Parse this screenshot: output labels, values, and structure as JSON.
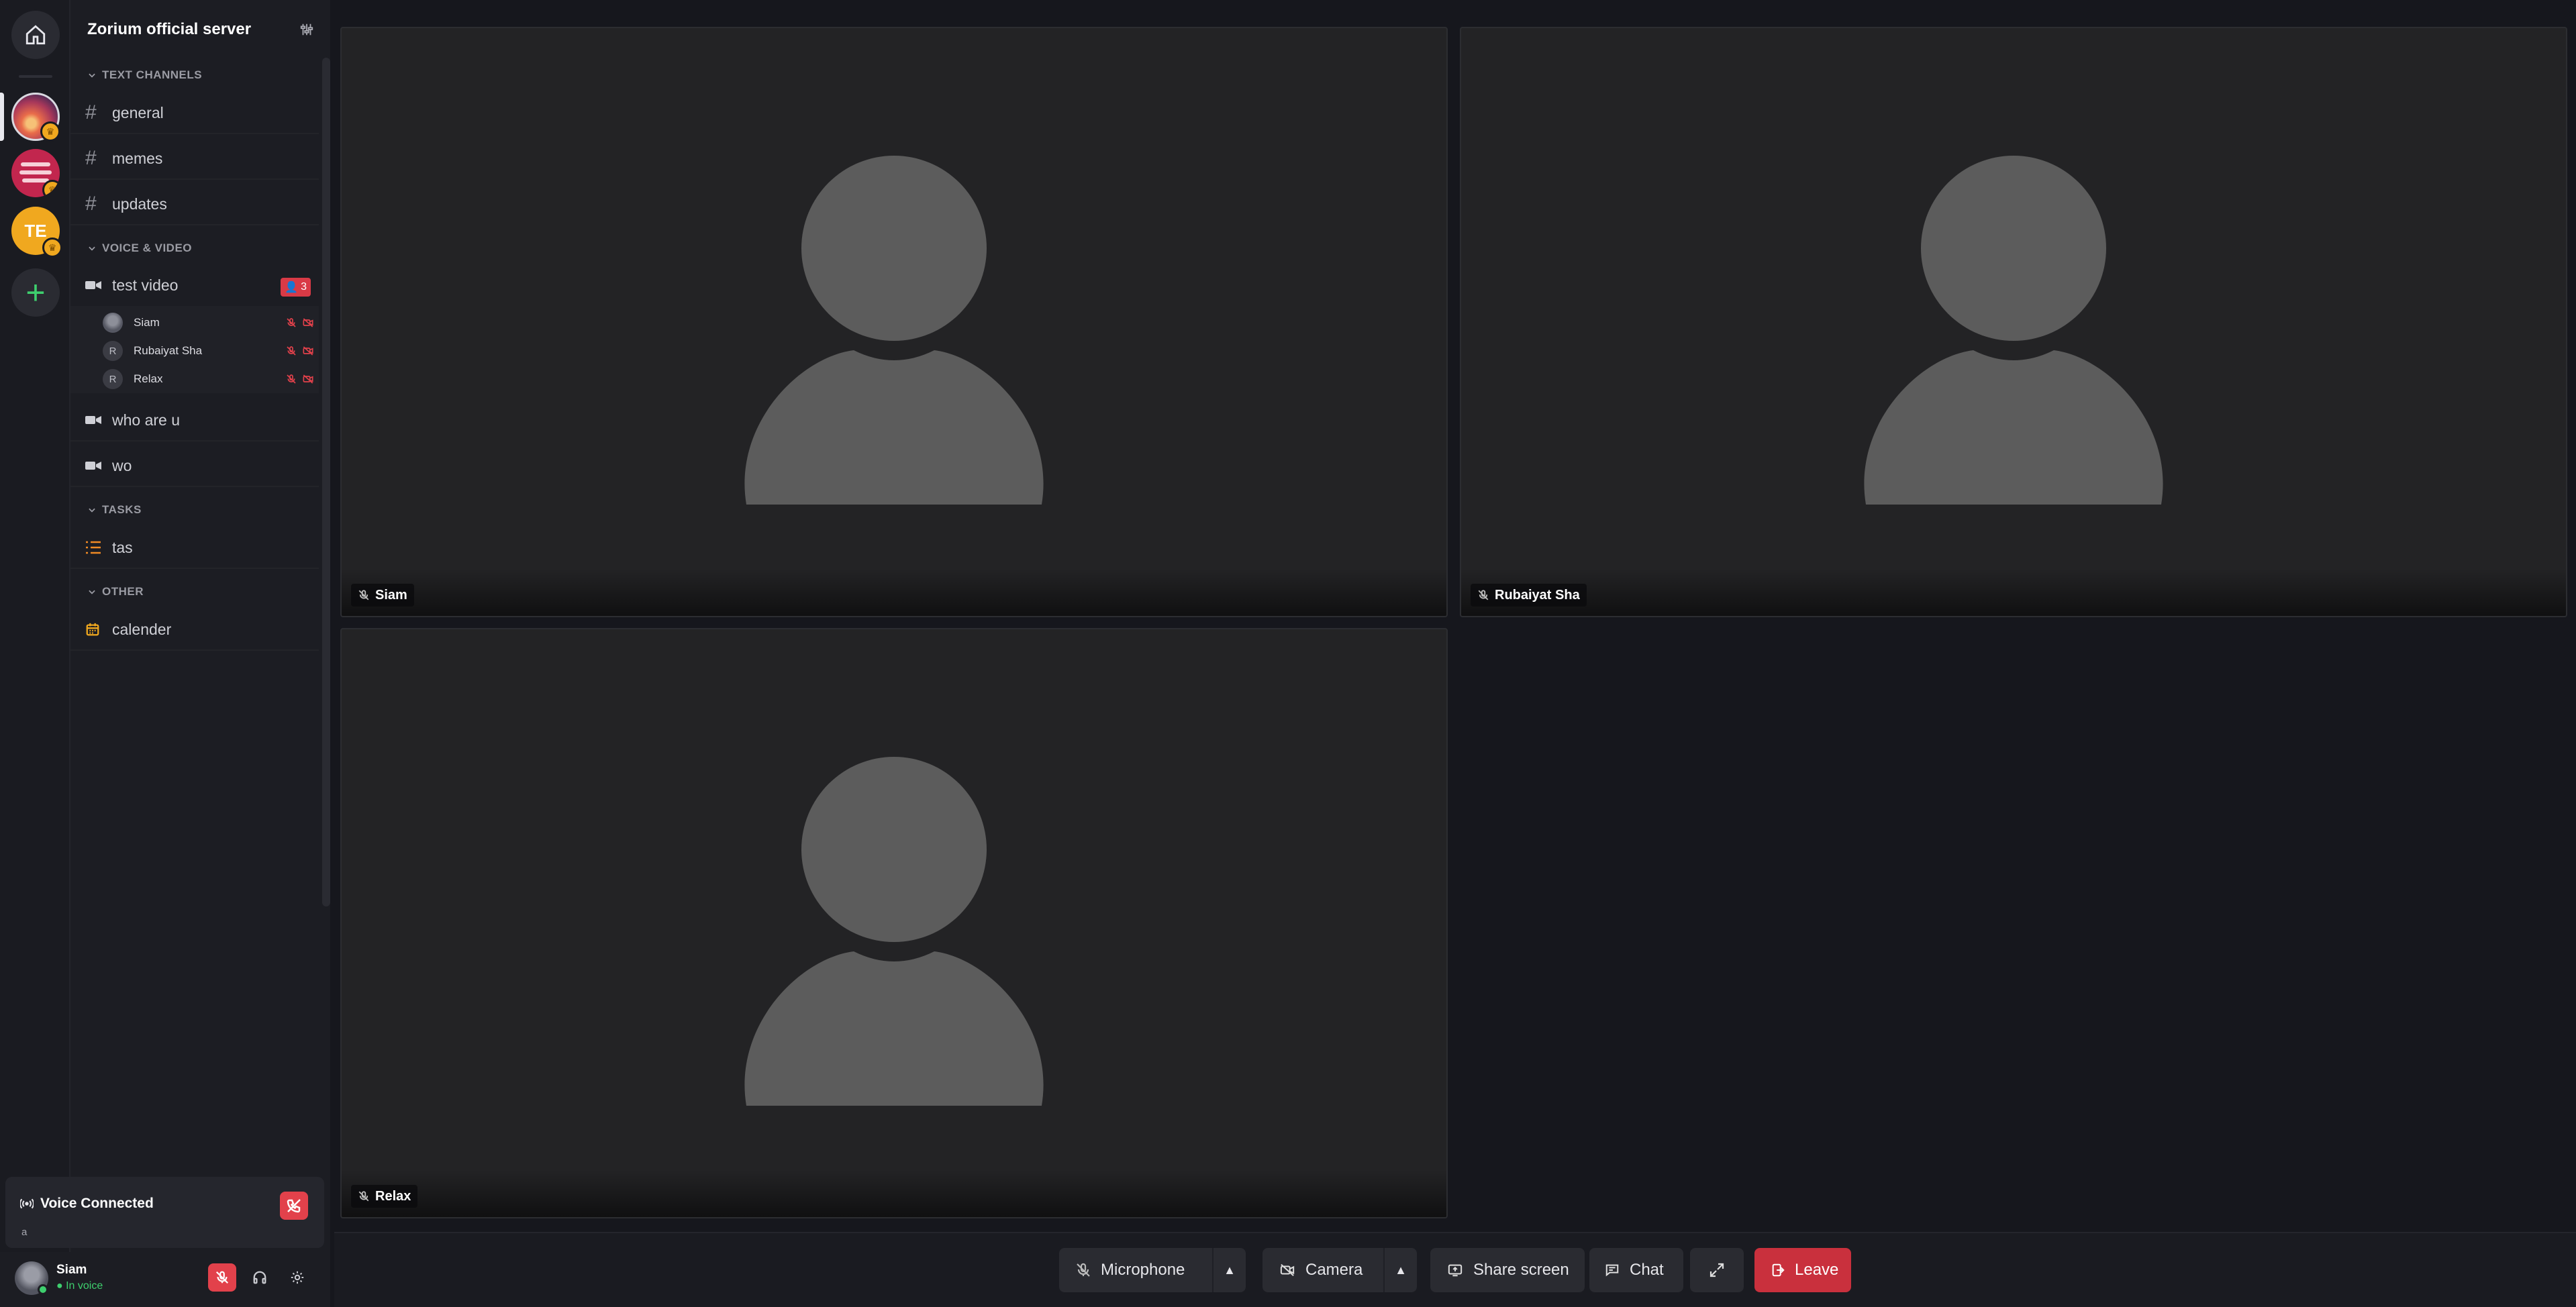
{
  "server": {
    "name": "Zorium official server",
    "badge_initials": "TE"
  },
  "categories": {
    "text": "TEXT CHANNELS",
    "voice": "VOICE & VIDEO",
    "tasks": "TASKS",
    "other": "OTHER"
  },
  "text_channels": [
    "general",
    "memes",
    "updates"
  ],
  "voice_channels": [
    {
      "name": "test video",
      "member_count": "3"
    },
    {
      "name": "who are u"
    },
    {
      "name": "wo"
    }
  ],
  "voice_members": [
    {
      "name": "Siam",
      "initial": ""
    },
    {
      "name": "Rubaiyat Sha",
      "initial": "R"
    },
    {
      "name": "Relax",
      "initial": "R"
    }
  ],
  "task_channels": [
    "tas"
  ],
  "other_channels": [
    "calender"
  ],
  "voice_panel": {
    "title": "Voice Connected",
    "subtitle": "a"
  },
  "user": {
    "name": "Siam",
    "status": "In voice"
  },
  "tiles": [
    {
      "name": "Siam"
    },
    {
      "name": "Rubaiyat Sha"
    },
    {
      "name": "Relax"
    }
  ],
  "controls": {
    "microphone": "Microphone",
    "camera": "Camera",
    "share": "Share screen",
    "chat": "Chat",
    "leave": "Leave"
  },
  "colors": {
    "danger": "#e2414b",
    "online": "#3ecf6e",
    "accent_gold": "#f0a81f"
  }
}
